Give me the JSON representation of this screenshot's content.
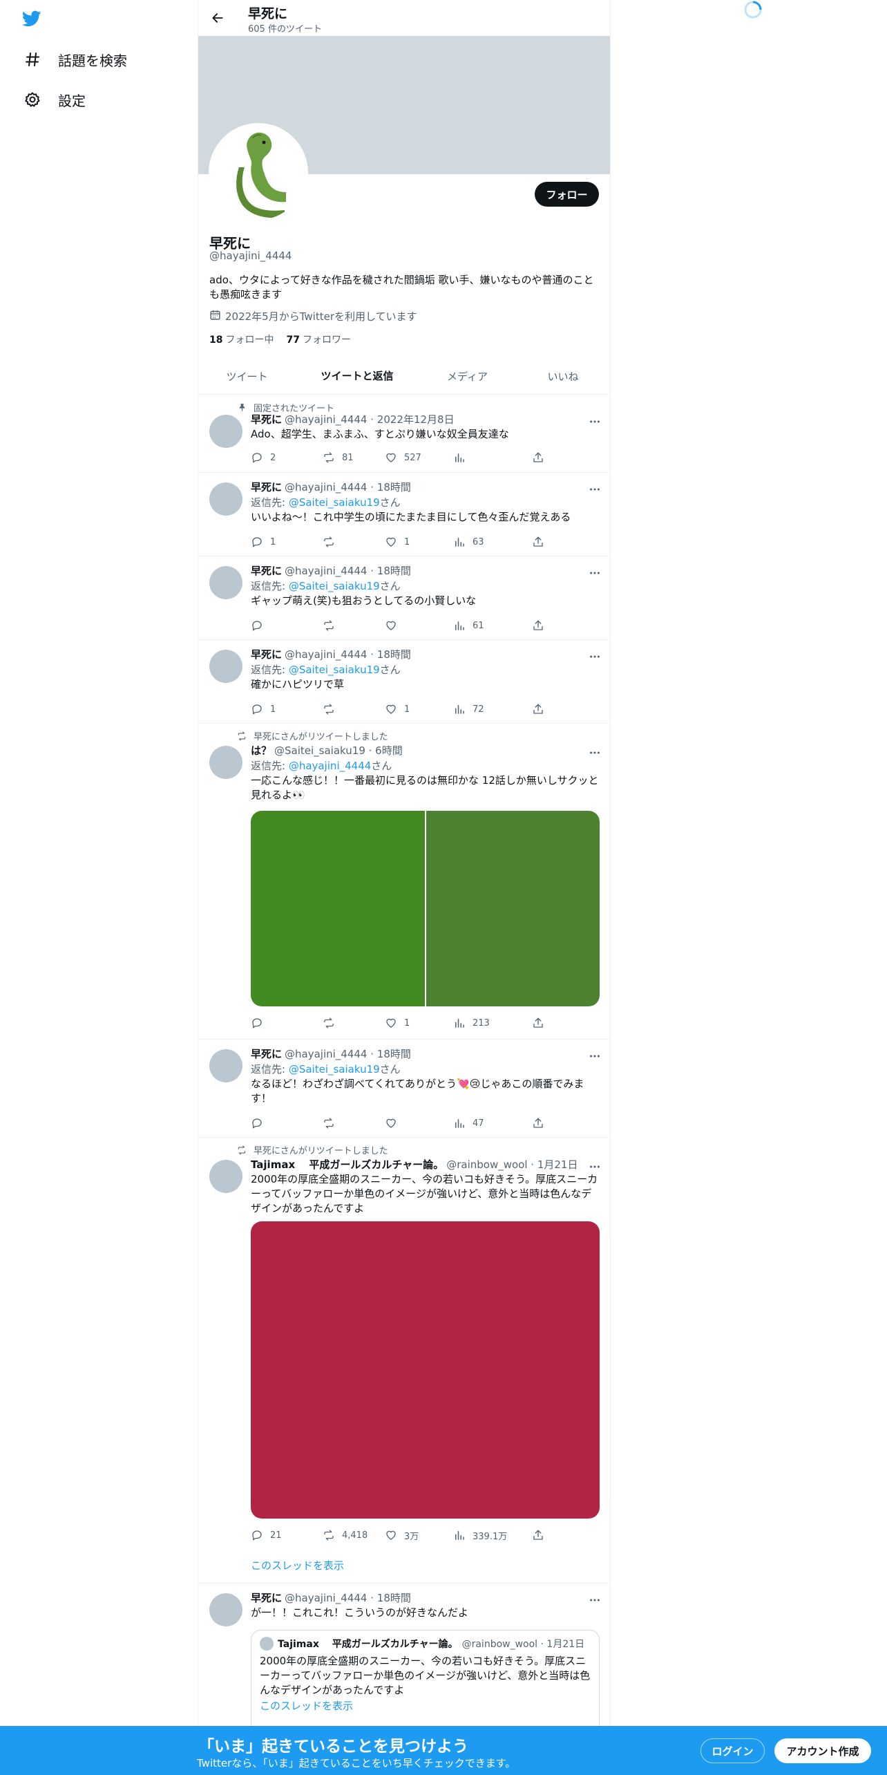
{
  "colors": {
    "accent": "#1d9bf0",
    "banner": "#cfd9de",
    "text": "#0f1419",
    "muted": "#536471"
  },
  "nav": {
    "logo": "twitter-bird-icon",
    "items": [
      {
        "label": "話題を検索",
        "icon": "hashtag-icon"
      },
      {
        "label": "設定",
        "icon": "gear-icon"
      }
    ]
  },
  "header": {
    "name": "早死に",
    "tweet_count": "605 件のツイート"
  },
  "profile": {
    "follow_label": "フォロー",
    "name": "早死に",
    "handle": "@hayajini_4444",
    "bio": "ado、ウタによって好きな作品を穢された閻鍋垢 歌い手、嫌いなものや普通のことも愚痴呟きます",
    "joined": "2022年5月からTwitterを利用しています",
    "following_count": "18",
    "following_label": "フォロー中",
    "followers_count": "77",
    "followers_label": "フォロワー"
  },
  "tabs": [
    "ツイート",
    "ツイートと返信",
    "メディア",
    "いいね"
  ],
  "tweets": [
    {
      "social": "固定されたツイート",
      "name": "早死に",
      "meta": "@hayajini_4444 · 2022年12月8日",
      "text": "Ado、超学生、まふまふ、すとぷり嫌いな奴全員友達な",
      "reply": "2",
      "retweet": "81",
      "like": "527",
      "views": ""
    },
    {
      "name": "早死に",
      "meta": "@hayajini_4444 · 18時間",
      "reply_prefix": "返信先: ",
      "reply_to": "@Saitei_saiaku19",
      "reply_suffix": "さん",
      "text": "いいよね〜！これ中学生の頃にたまたま目にして色々歪んだ覚えある",
      "reply": "1",
      "retweet": "",
      "like": "1",
      "views": "63"
    },
    {
      "name": "早死に",
      "meta": "@hayajini_4444 · 18時間",
      "reply_prefix": "返信先: ",
      "reply_to": "@Saitei_saiaku19",
      "reply_suffix": "さん",
      "text": "ギャップ萌え(笑)も狙おうとしてるの小賢しいな",
      "reply": "",
      "retweet": "",
      "like": "",
      "views": "61"
    },
    {
      "name": "早死に",
      "meta": "@hayajini_4444 · 18時間",
      "reply_prefix": "返信先: ",
      "reply_to": "@Saitei_saiaku19",
      "reply_suffix": "さん",
      "text": "確かにハピツリで草",
      "reply": "1",
      "retweet": "",
      "like": "1",
      "views": "72"
    },
    {
      "social": "早死にさんがリツイートしました",
      "name": "は？",
      "meta": "@Saitei_saiaku19 · 6時間",
      "reply_prefix": "返信先: ",
      "reply_to": "@hayajini_4444",
      "reply_suffix": "さん",
      "text": "一応こんな感じ！！一番最初に見るのは無印かな 12話しか無いしサクッと見れるよ👀",
      "media_colors": [
        "#428a1f",
        "#4d8330"
      ],
      "reply": "",
      "retweet": "",
      "like": "1",
      "views": "213"
    },
    {
      "name": "早死に",
      "meta": "@hayajini_4444 · 18時間",
      "reply_prefix": "返信先: ",
      "reply_to": "@Saitei_saiaku19",
      "reply_suffix": "さん",
      "text": "なるほど！わざわざ調べてくれてありがとう💘😢じゃあこの順番でみます！",
      "reply": "",
      "retweet": "",
      "like": "",
      "views": "47"
    },
    {
      "social": "早死にさんがリツイートしました",
      "name": "Tajimax　 平成ガールズカルチャー論。",
      "meta": "@rainbow_wool · 1月21日",
      "text": "2000年の厚底全盛期のスニーカー、今の若いコも好きそう。厚底スニーカーってバッファローか単色のイメージが強いけど、意外と当時は色んなデザインがあったんですよ",
      "media_colors": [
        "#b12542"
      ],
      "reply": "21",
      "retweet": "4,418",
      "like": "3万",
      "views": "339.1万",
      "show_thread": "このスレッドを表示"
    },
    {
      "name": "早死に",
      "meta": "@hayajini_4444 · 18時間",
      "text": "が一！！これこれ！こういうのが好きなんだよ",
      "quote": {
        "name": "Tajimax　 平成ガールズカルチャー論。",
        "meta": "@rainbow_wool · 1月21日",
        "text": "2000年の厚底全盛期のスニーカー、今の若いコも好きそう。厚底スニーカーってバッファローか単色のイメージが強いけど、意外と当時は色んなデザインがあったんですよ",
        "show_thread": "このスレッドを表示"
      }
    }
  ],
  "bottom": {
    "title": "「いま」起きていることを見つけよう",
    "subtitle": "Twitterなら、「いま」起きていることをいち早くチェックできます。",
    "login": "ログイン",
    "signup": "アカウント作成"
  }
}
